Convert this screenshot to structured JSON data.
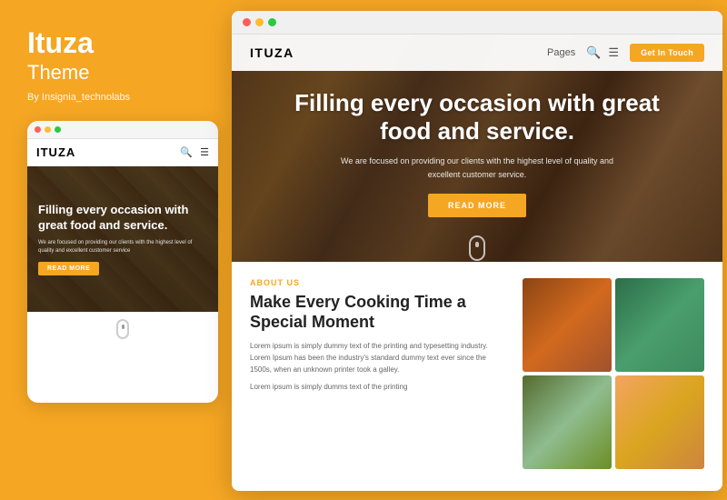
{
  "brand": {
    "title": "Ituza",
    "subtitle": "Theme",
    "by": "By Insignia_technolabs"
  },
  "browser_dots": {
    "dot1": "●",
    "dot2": "●",
    "dot3": "●"
  },
  "mobile": {
    "logo": "ITUZA",
    "hero_title": "Filling every occasion with great food and service.",
    "hero_subtitle": "We are focused on providing our clients with the highest level of quality and excellent customer service",
    "read_more": "READ MORE"
  },
  "desktop": {
    "logo": "ITUZA",
    "nav_pages": "Pages",
    "get_in_touch": "Get In Touch",
    "hero_title": "Filling every occasion with great food and service.",
    "hero_desc": "We are focused on providing our clients with the highest level of quality and excellent customer service.",
    "read_more": "READ MORE",
    "about_us_label": "ABOUT US",
    "content_title": "Make Every Cooking Time a Special Moment",
    "para1": "Lorem ipsum is simply dummy text of the printing and typesetting industry. Lorem Ipsum has been the industry's standard dummy text ever since the 1500s, when an unknown printer took a galley.",
    "para2": "Lorem ipsum is simply dumms text of the printing"
  },
  "colors": {
    "accent": "#F5A623",
    "white": "#ffffff",
    "dark": "#222222",
    "gray": "#666666"
  }
}
